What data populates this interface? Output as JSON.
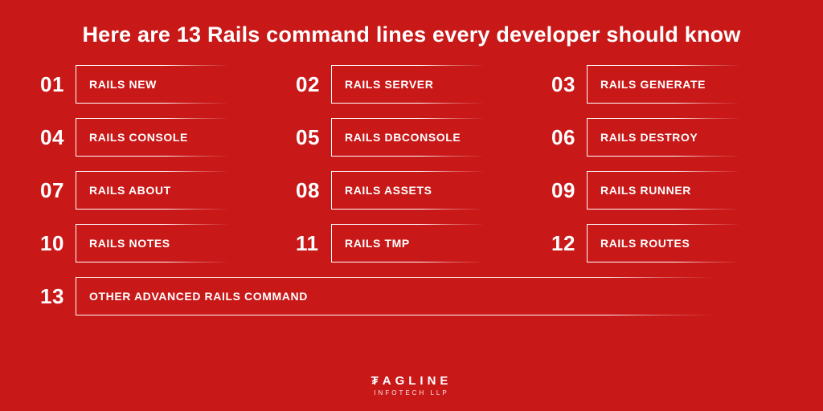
{
  "title": "Here are 13 Rails command lines every developer should know",
  "items": [
    {
      "num": "01",
      "label": "RAILS NEW"
    },
    {
      "num": "02",
      "label": "RAILS SERVER"
    },
    {
      "num": "03",
      "label": "RAILS GENERATE"
    },
    {
      "num": "04",
      "label": "RAILS CONSOLE"
    },
    {
      "num": "05",
      "label": "RAILS DBCONSOLE"
    },
    {
      "num": "06",
      "label": "RAILS DESTROY"
    },
    {
      "num": "07",
      "label": "RAILS ABOUT"
    },
    {
      "num": "08",
      "label": "RAILS ASSETS"
    },
    {
      "num": "09",
      "label": "RAILS RUNNER"
    },
    {
      "num": "10",
      "label": "RAILS NOTES"
    },
    {
      "num": "11",
      "label": "RAILS TMP"
    },
    {
      "num": "12",
      "label": "RAILS ROUTES"
    },
    {
      "num": "13",
      "label": "OTHER ADVANCED RAILS COMMAND"
    }
  ],
  "brand": {
    "name": "₮AGLINE",
    "sub": "INFOTECH LLP"
  }
}
